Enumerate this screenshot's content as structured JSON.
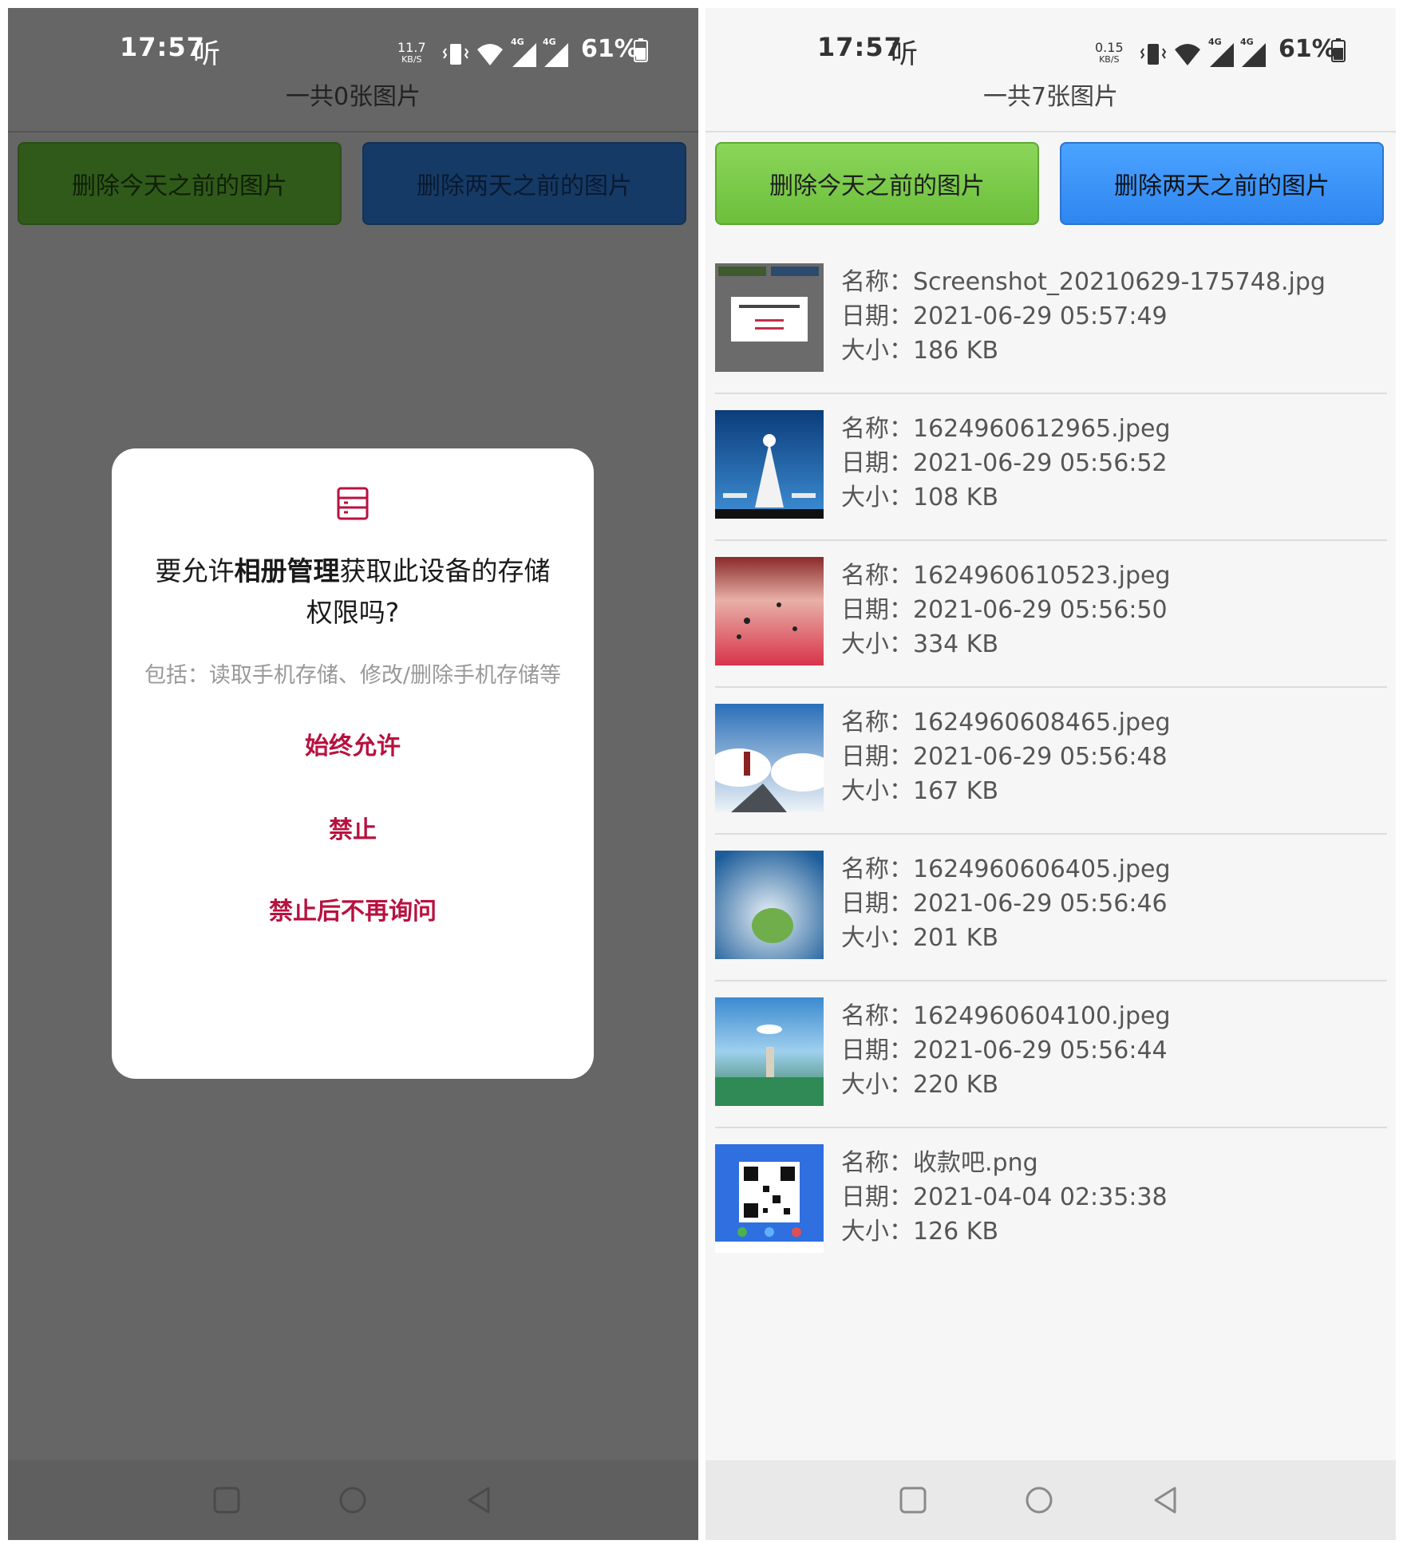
{
  "left_screen": {
    "status": {
      "time": "17:57",
      "extra": "听",
      "speed_value": "11.7",
      "speed_unit": "KB/S",
      "network_1": "4G",
      "network_2": "4G",
      "battery": "61%"
    },
    "title": "一共0张图片",
    "buttons": {
      "delete_today": "删除今天之前的图片",
      "delete_two_days": "删除两天之前的图片"
    },
    "dialog": {
      "icon": "storage-icon",
      "title_prefix": "要允许",
      "title_app": "相册管理",
      "title_suffix": "获取此设备的存储权限吗?",
      "description": "包括：读取手机存储、修改/删除手机存储等",
      "actions": [
        "始终允许",
        "禁止",
        "禁止后不再询问"
      ]
    }
  },
  "right_screen": {
    "status": {
      "time": "17:57",
      "extra": "听",
      "speed_value": "0.15",
      "speed_unit": "KB/S",
      "network_1": "4G",
      "network_2": "4G",
      "battery": "61%"
    },
    "title": "一共7张图片",
    "buttons": {
      "delete_today": "删除今天之前的图片",
      "delete_two_days": "删除两天之前的图片"
    },
    "labels": {
      "name": "名称：",
      "date": "日期：",
      "size": "大小："
    },
    "images": [
      {
        "name": "Screenshot_20210629-175748.jpg",
        "date": "2021-06-29 05:57:49",
        "size": "186 KB"
      },
      {
        "name": "1624960612965.jpeg",
        "date": "2021-06-29 05:56:52",
        "size": "108 KB"
      },
      {
        "name": "1624960610523.jpeg",
        "date": "2021-06-29 05:56:50",
        "size": "334 KB"
      },
      {
        "name": "1624960608465.jpeg",
        "date": "2021-06-29 05:56:48",
        "size": "167 KB"
      },
      {
        "name": "1624960606405.jpeg",
        "date": "2021-06-29 05:56:46",
        "size": "201 KB"
      },
      {
        "name": "1624960604100.jpeg",
        "date": "2021-06-29 05:56:44",
        "size": "220 KB"
      },
      {
        "name": "收款吧.png",
        "date": "2021-04-04 02:35:38",
        "size": "126 KB"
      }
    ]
  },
  "navbar": {
    "icons": [
      "recent-apps-icon",
      "home-icon",
      "back-icon"
    ]
  },
  "colors": {
    "accent": "#b8113f",
    "green_button": "#6dbf3c",
    "blue_button": "#2f86f0"
  }
}
